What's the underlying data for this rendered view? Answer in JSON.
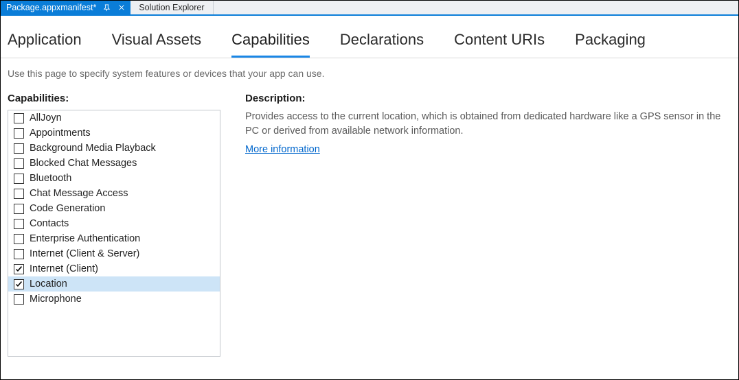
{
  "tabs": {
    "active": "Package.appxmanifest*",
    "inactive": "Solution Explorer"
  },
  "nav": {
    "items": [
      "Application",
      "Visual Assets",
      "Capabilities",
      "Declarations",
      "Content URIs",
      "Packaging"
    ],
    "activeIndex": 2
  },
  "subtext": "Use this page to specify system features or devices that your app can use.",
  "capabilities": {
    "label": "Capabilities:",
    "items": [
      {
        "label": "AllJoyn",
        "checked": false,
        "selected": false
      },
      {
        "label": "Appointments",
        "checked": false,
        "selected": false
      },
      {
        "label": "Background Media Playback",
        "checked": false,
        "selected": false
      },
      {
        "label": "Blocked Chat Messages",
        "checked": false,
        "selected": false
      },
      {
        "label": "Bluetooth",
        "checked": false,
        "selected": false
      },
      {
        "label": "Chat Message Access",
        "checked": false,
        "selected": false
      },
      {
        "label": "Code Generation",
        "checked": false,
        "selected": false
      },
      {
        "label": "Contacts",
        "checked": false,
        "selected": false
      },
      {
        "label": "Enterprise Authentication",
        "checked": false,
        "selected": false
      },
      {
        "label": "Internet (Client & Server)",
        "checked": false,
        "selected": false
      },
      {
        "label": "Internet (Client)",
        "checked": true,
        "selected": false
      },
      {
        "label": "Location",
        "checked": true,
        "selected": true
      },
      {
        "label": "Microphone",
        "checked": false,
        "selected": false
      }
    ]
  },
  "description": {
    "label": "Description:",
    "text": "Provides access to the current location, which is obtained from dedicated hardware like a GPS sensor in the PC or derived from available network information.",
    "link": "More information"
  }
}
